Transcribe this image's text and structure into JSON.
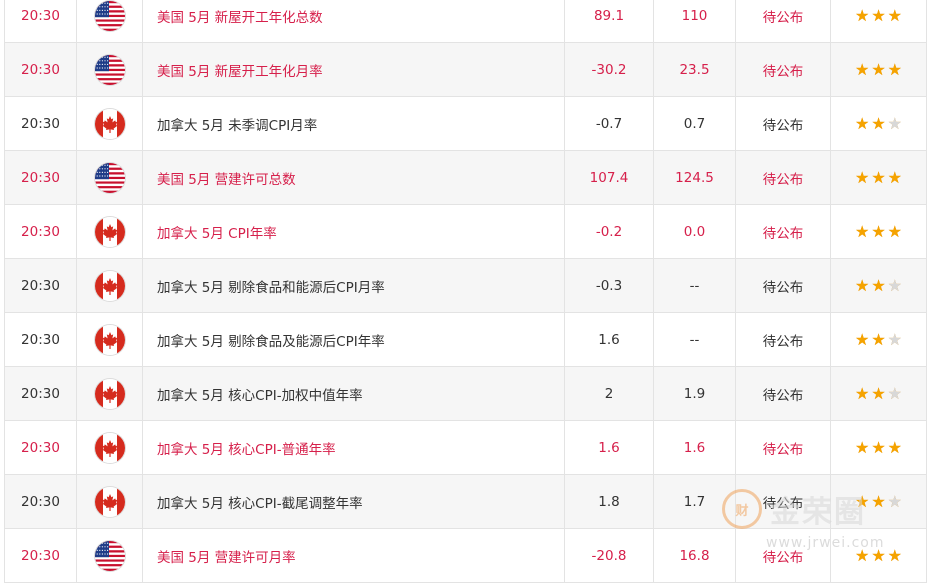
{
  "rows": [
    {
      "time": "20:30",
      "country": "us",
      "event": "美国 5月 新屋开工年化总数",
      "previous": "89.1",
      "forecast": "110",
      "actual": "待公布",
      "stars": 3,
      "highlight": true
    },
    {
      "time": "20:30",
      "country": "us",
      "event": "美国 5月 新屋开工年化月率",
      "previous": "-30.2",
      "forecast": "23.5",
      "actual": "待公布",
      "stars": 3,
      "highlight": true
    },
    {
      "time": "20:30",
      "country": "ca",
      "event": "加拿大 5月 未季调CPI月率",
      "previous": "-0.7",
      "forecast": "0.7",
      "actual": "待公布",
      "stars": 2,
      "highlight": false
    },
    {
      "time": "20:30",
      "country": "us",
      "event": "美国 5月 营建许可总数",
      "previous": "107.4",
      "forecast": "124.5",
      "actual": "待公布",
      "stars": 3,
      "highlight": true
    },
    {
      "time": "20:30",
      "country": "ca",
      "event": "加拿大 5月 CPI年率",
      "previous": "-0.2",
      "forecast": "0.0",
      "actual": "待公布",
      "stars": 3,
      "highlight": true
    },
    {
      "time": "20:30",
      "country": "ca",
      "event": "加拿大 5月 剔除食品和能源后CPI月率",
      "previous": "-0.3",
      "forecast": "--",
      "actual": "待公布",
      "stars": 2,
      "highlight": false
    },
    {
      "time": "20:30",
      "country": "ca",
      "event": "加拿大 5月 剔除食品及能源后CPI年率",
      "previous": "1.6",
      "forecast": "--",
      "actual": "待公布",
      "stars": 2,
      "highlight": false
    },
    {
      "time": "20:30",
      "country": "ca",
      "event": "加拿大 5月 核心CPI-加权中值年率",
      "previous": "2",
      "forecast": "1.9",
      "actual": "待公布",
      "stars": 2,
      "highlight": false
    },
    {
      "time": "20:30",
      "country": "ca",
      "event": "加拿大 5月 核心CPI-普通年率",
      "previous": "1.6",
      "forecast": "1.6",
      "actual": "待公布",
      "stars": 3,
      "highlight": true
    },
    {
      "time": "20:30",
      "country": "ca",
      "event": "加拿大 5月 核心CPI-截尾调整年率",
      "previous": "1.8",
      "forecast": "1.7",
      "actual": "待公布",
      "stars": 2,
      "highlight": false
    },
    {
      "time": "20:30",
      "country": "us",
      "event": "美国 5月 营建许可月率",
      "previous": "-20.8",
      "forecast": "16.8",
      "actual": "待公布",
      "stars": 3,
      "highlight": true
    }
  ],
  "watermark": {
    "logo": "财",
    "title": "金荣圈",
    "url": "www.jrwei.com"
  },
  "colors": {
    "highlight": "#d6204b",
    "normal": "#333333",
    "star_on": "#f5a300",
    "star_off": "#d8d8d8"
  }
}
